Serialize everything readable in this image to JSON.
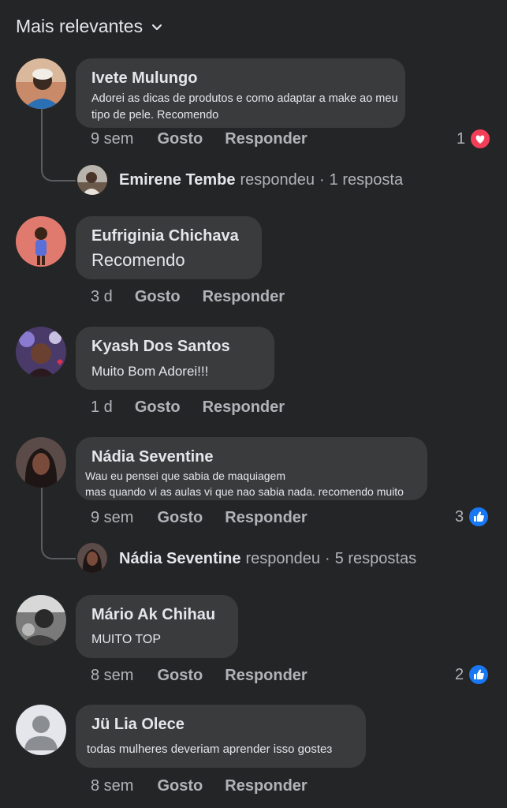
{
  "header": {
    "sort_label": "Mais relevantes"
  },
  "icons": {
    "sort": "chevron-down-icon",
    "love": "heart-reaction-icon",
    "like": "like-reaction-icon"
  },
  "colors": {
    "background": "#242526",
    "bubble": "#3a3b3c",
    "love": "#f33e58",
    "like": "#1877f2"
  },
  "comments": [
    {
      "author": "Ivete Mulungo",
      "text": "Adorei as dicas de produtos e como adaptar a make ao meu tipo de pele. Recomendo",
      "text_lines": [
        "Adorei as dicas de produtos e como adaptar a make ao meu",
        "tipo de pele. Recomendo"
      ],
      "time": "9 sem",
      "like_label": "Gosto",
      "reply_label": "Responder",
      "reaction": {
        "count": "1",
        "type": "love"
      },
      "replies": {
        "name": "Emirene Tembe",
        "verb": "respondeu",
        "count": "1 resposta"
      }
    },
    {
      "author": "Eufriginia Chichava",
      "text": "Recomendo",
      "time": "3 d",
      "like_label": "Gosto",
      "reply_label": "Responder"
    },
    {
      "author": "Kyash Dos Santos",
      "text": "Muito Bom Adorei!!!",
      "time": "1 d",
      "like_label": "Gosto",
      "reply_label": "Responder"
    },
    {
      "author": "Nádia Seventine",
      "text": "Wau eu pensei que sabia de maquiagem mas quando vi as aulas vi que nao sabia nada. recomendo muito",
      "text_lines": [
        "Wau eu pensei que sabia de maquiagem",
        "mas quando vi as aulas vi que nao sabia nada. recomendo muito"
      ],
      "time": "9 sem",
      "like_label": "Gosto",
      "reply_label": "Responder",
      "reaction": {
        "count": "3",
        "type": "like"
      },
      "replies": {
        "name": "Nádia Seventine",
        "verb": "respondeu",
        "count": "5 respostas"
      }
    },
    {
      "author": "Mário Ak Chihau",
      "text": "MUITO TOP",
      "time": "8 sem",
      "like_label": "Gosto",
      "reply_label": "Responder",
      "reaction": {
        "count": "2",
        "type": "like"
      }
    },
    {
      "author": "Jü Lia Olece",
      "text": "todas mulheres deveriam aprender isso gosteɜ",
      "time": "8 sem",
      "like_label": "Gosto",
      "reply_label": "Responder"
    }
  ]
}
